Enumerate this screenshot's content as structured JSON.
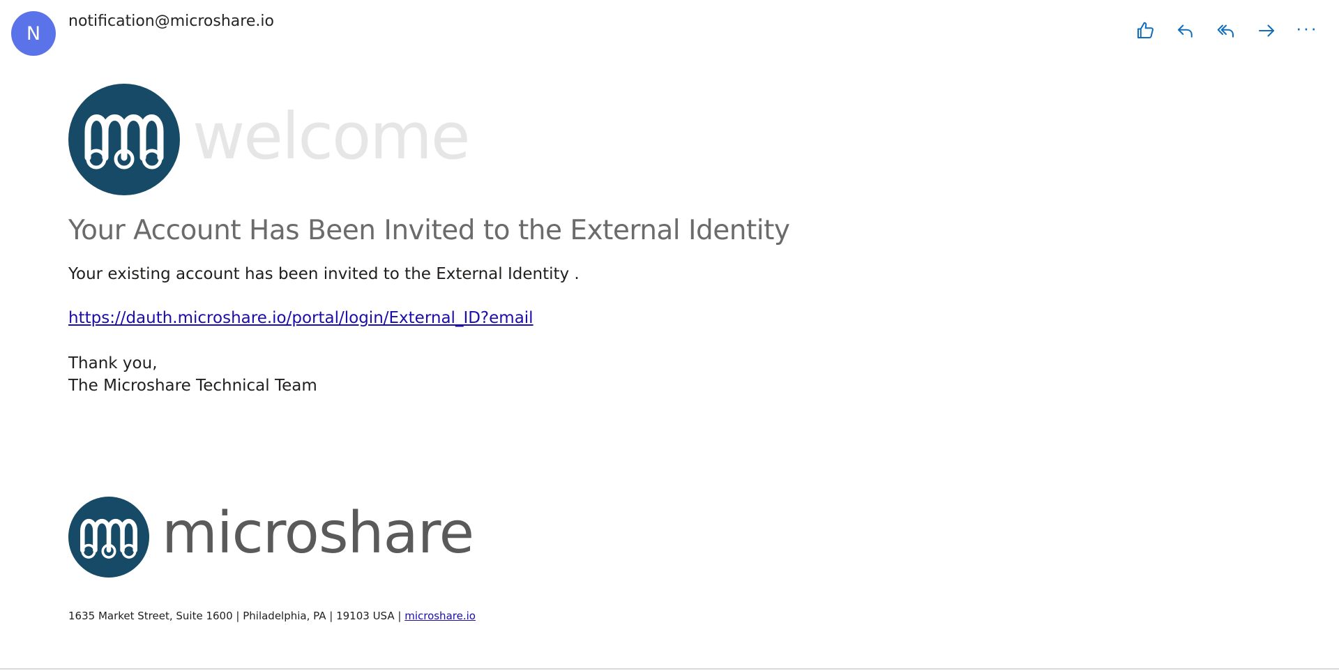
{
  "header": {
    "avatar_initial": "N",
    "sender": "notification@microshare.io",
    "actions": {
      "like": "like-icon",
      "reply": "reply-icon",
      "reply_all": "reply-all-icon",
      "forward": "forward-icon",
      "more": "···"
    }
  },
  "message": {
    "welcome_word": "welcome",
    "title": "Your Account Has Been Invited to the External Identity",
    "invite_line": "Your existing account has been invited to the External Identity .",
    "link": "https://dauth.microshare.io/portal/login/External_ID?email",
    "thanks": "Thank you,",
    "team": "The Microshare Technical Team"
  },
  "footer": {
    "brand": "microshare",
    "address": "1635 Market Street, Suite 1600 | Philadelphia, PA | 19103 USA | ",
    "site_link": "microshare.io"
  },
  "colors": {
    "avatar": "#5b73e8",
    "action_icons": "#0f6cbd",
    "logo_circle": "#174a66",
    "link": "#1a0dab"
  }
}
